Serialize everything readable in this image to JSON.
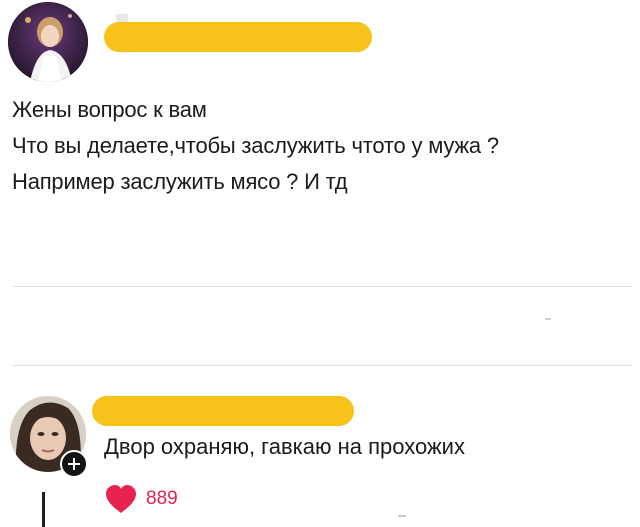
{
  "post": {
    "text_lines": [
      "Жены вопрос к вам",
      "Что вы делаете,чтобы заслужить чтото у мужа ?",
      "Например заслужить мясо ? И тд"
    ]
  },
  "comment": {
    "text": "Двор охраняю, гавкаю на прохожих",
    "likes": "889"
  },
  "colors": {
    "redaction": "#f7c21a",
    "like": "#e8234f",
    "divider": "#e3e3e3",
    "badge": "#141414"
  },
  "icons": {
    "post_avatar": "avatar",
    "comment_avatar": "avatar",
    "badge": "plus-icon",
    "like": "heart-icon"
  }
}
